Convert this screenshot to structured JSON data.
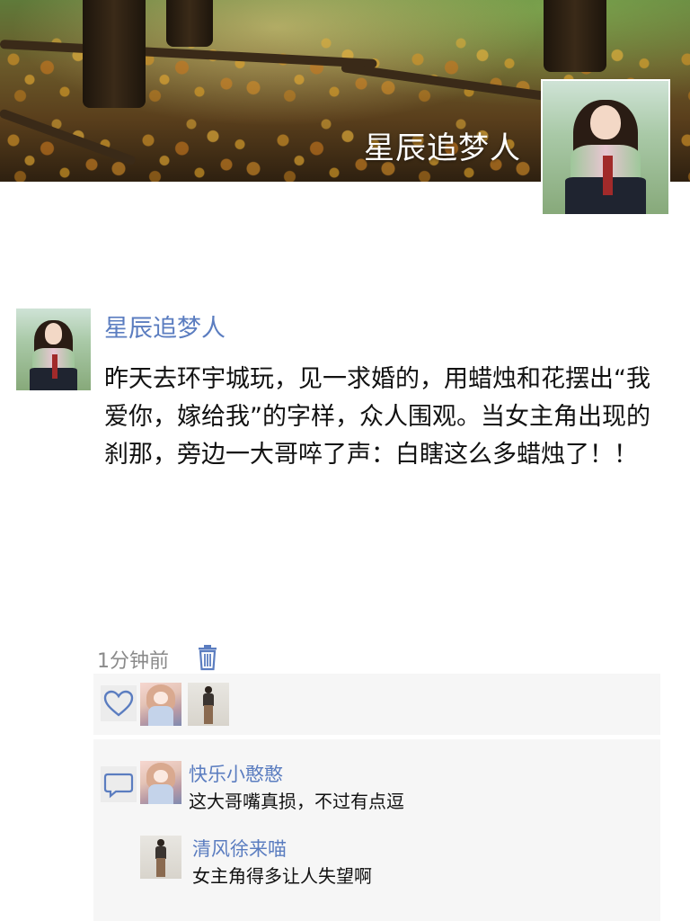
{
  "cover": {
    "display_name": "星辰追梦人"
  },
  "post": {
    "author": "星辰追梦人",
    "text": "昨天去环宇城玩，见一求婚的，用蜡烛和花摆出“我爱你，嫁给我”的字样，众人围观。当女主角出现的刹那，旁边一大哥啐了声：白瞎这么多蜡烛了！！",
    "timestamp": "1分钟前",
    "delete_icon": "trash-icon"
  },
  "likes": {
    "icon": "heart-outline-icon"
  },
  "comments": {
    "icon": "comment-bubble-icon",
    "items": [
      {
        "author": "快乐小憨憨",
        "text": "这大哥嘴真损，不过有点逗"
      },
      {
        "author": "清风徐来喵",
        "text": "女主角得多让人失望啊"
      }
    ]
  },
  "colors": {
    "link_blue": "#5b7dc0",
    "panel_bg": "#f6f6f6",
    "text_dark": "#111111",
    "text_gray": "#8a8a8a"
  }
}
